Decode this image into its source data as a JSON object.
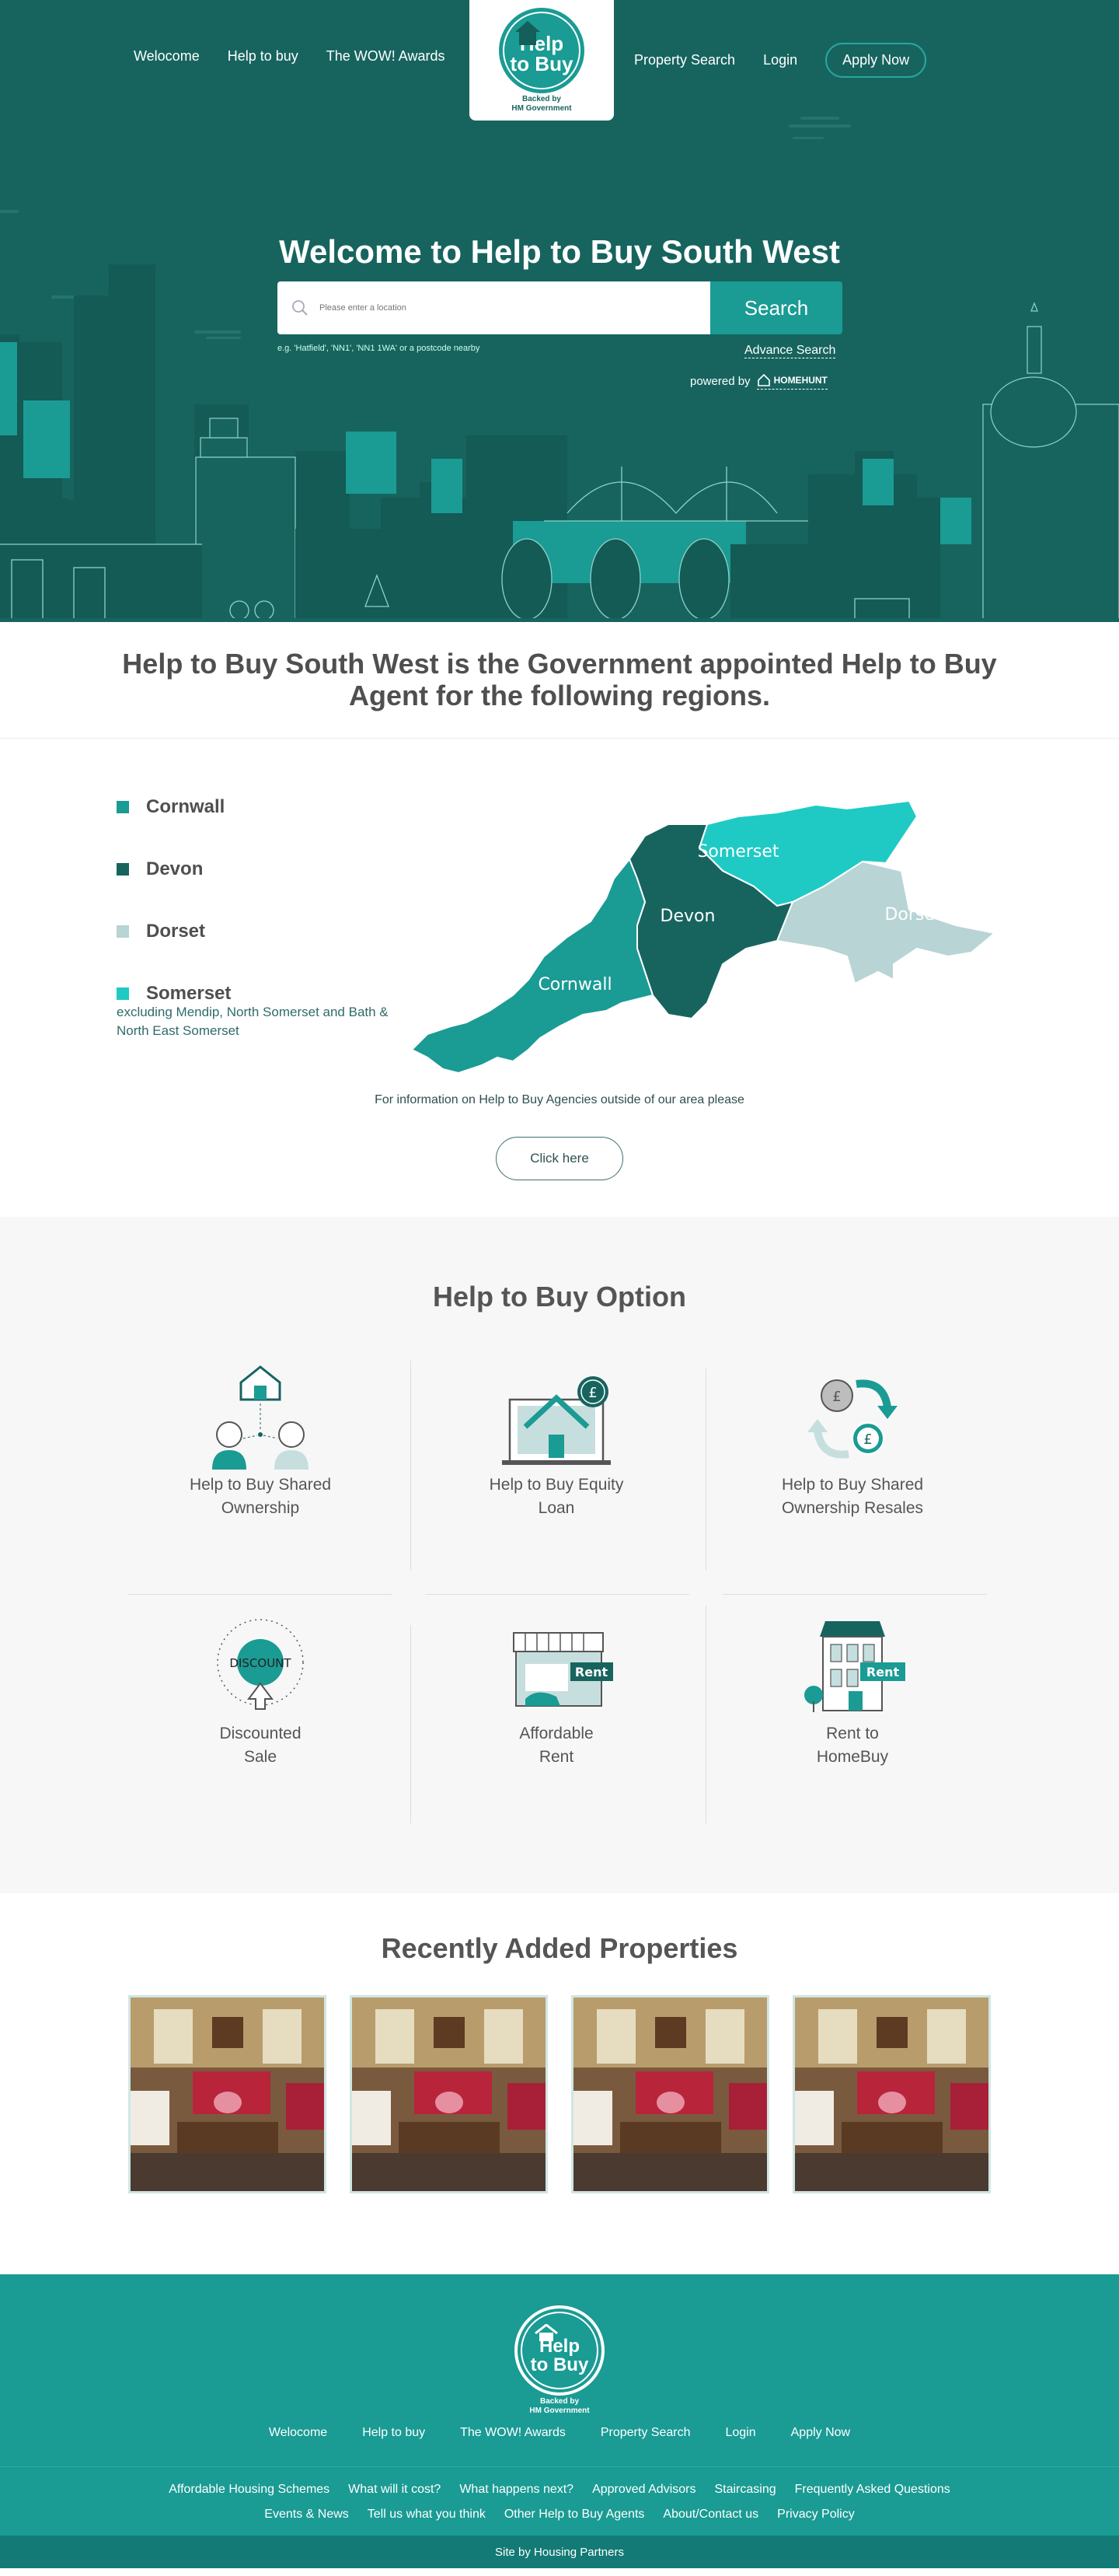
{
  "header": {
    "nav_left": [
      "Welocome",
      "Help to buy",
      "The WOW! Awards"
    ],
    "nav_right": [
      "Property Search",
      "Login"
    ],
    "apply_label": "Apply Now",
    "logo_line1": "Help",
    "logo_line2": "to Buy",
    "logo_sub1": "Backed by",
    "logo_sub2": "HM Government"
  },
  "hero": {
    "title": "Welcome to Help to Buy South West",
    "search_placeholder": "Please enter a location",
    "search_button": "Search",
    "search_hint": "e.g. 'Hatfield', 'NN1', 'NN1 1WA' or a postcode nearby",
    "advance_search": "Advance Search",
    "powered_by": "powered by",
    "powered_brand": "HOMEHUNT"
  },
  "intro": {
    "heading": "Help to Buy South West is the Government appointed Help to Buy Agent for the following regions."
  },
  "regions": {
    "items": [
      {
        "name": "Cornwall",
        "color": "#1a9b94"
      },
      {
        "name": "Devon",
        "color": "#17645f"
      },
      {
        "name": "Dorset",
        "color": "#b8d4d4"
      },
      {
        "name": "Somerset",
        "color": "#1fcac4"
      }
    ],
    "note": "excluding Mendip, North Somerset and Bath & North East Somerset",
    "map_labels": {
      "cornwall": "Cornwall",
      "devon": "Devon",
      "dorset": "Dorset",
      "somerset": "Somerset"
    },
    "info_text": "For information on Help to Buy Agencies outside of our area please",
    "click_label": "Click here"
  },
  "options": {
    "title": "Help to Buy Option",
    "items": [
      {
        "line1": "Help to Buy Shared",
        "line2": "Ownership"
      },
      {
        "line1": "Help to Buy Equity",
        "line2": "Loan"
      },
      {
        "line1": "Help to Buy Shared",
        "line2": "Ownership Resales"
      },
      {
        "line1": "Discounted",
        "line2": "Sale"
      },
      {
        "line1": "Affordable",
        "line2": "Rent"
      },
      {
        "line1": "Rent to",
        "line2": "HomeBuy"
      }
    ],
    "icon_text": {
      "pound": "£",
      "discount": "DISCOUNT",
      "rent": "Rent"
    }
  },
  "recent": {
    "title": "Recently Added Properties"
  },
  "footer": {
    "logo_line1": "Help",
    "logo_line2": "to Buy",
    "sub1": "Backed by",
    "sub2": "HM Government",
    "nav": [
      "Welocome",
      "Help to buy",
      "The WOW! Awards",
      "Property Search",
      "Login",
      "Apply Now"
    ],
    "links_row1": [
      "Affordable Housing Schemes",
      "What will it cost?",
      "What happens next?",
      "Approved Advisors",
      "Staircasing",
      "Frequently Asked Questions"
    ],
    "links_row2": [
      "Events & News",
      "Tell us what you think",
      "Other Help to Buy Agents",
      "About/Contact us",
      "Privacy Policy"
    ],
    "credit": "Site by Housing Partners"
  },
  "colors": {
    "hero_bg": "#17645f",
    "accent": "#1a9b94",
    "footer_bg": "#1a9b94"
  }
}
